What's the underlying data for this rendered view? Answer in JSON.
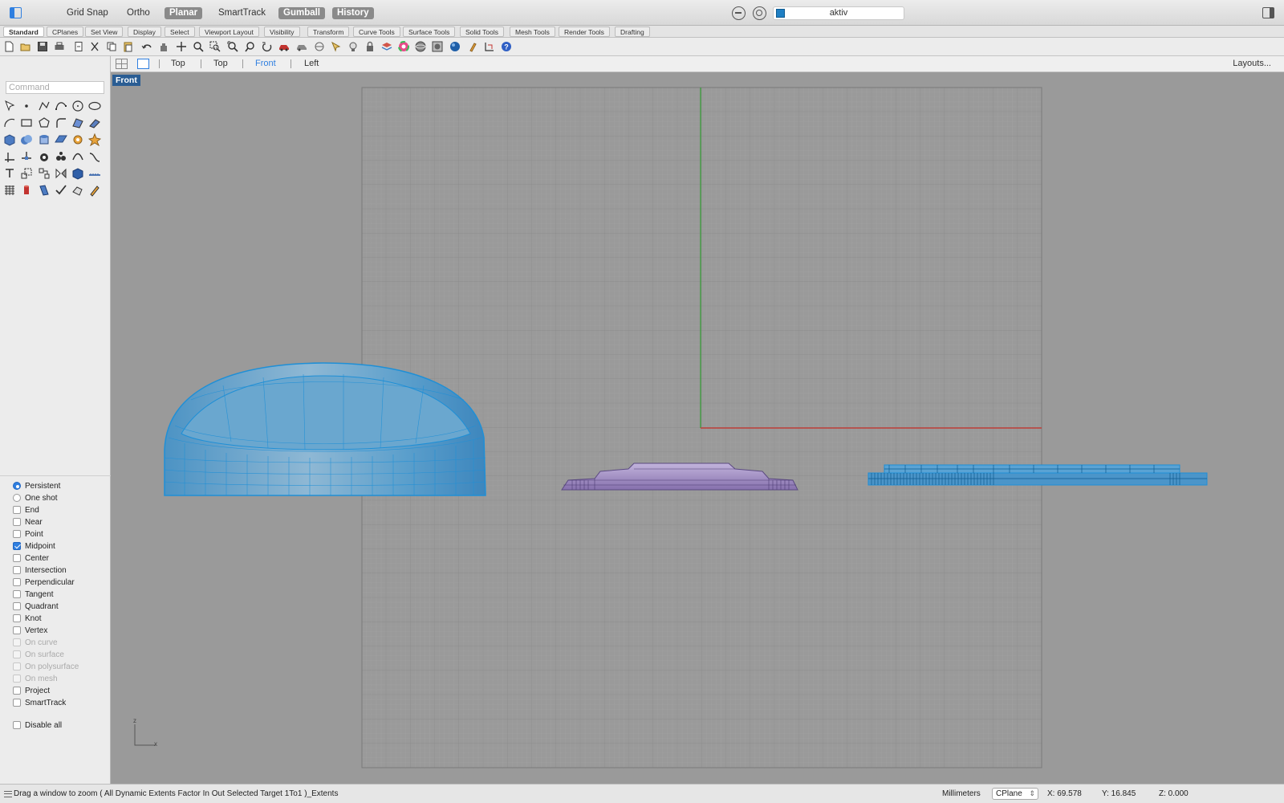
{
  "topbar": {
    "grid_snap": "Grid Snap",
    "ortho": "Ortho",
    "planar": "Planar",
    "smarttrack": "SmartTrack",
    "gumball": "Gumball",
    "history": "History",
    "layer_name": "aktiv",
    "layer_color": "#1f7fc4"
  },
  "tabs": [
    "Standard",
    "CPlanes",
    "Set View",
    "Display",
    "Select",
    "Viewport Layout",
    "Visibility",
    "Transform",
    "Curve Tools",
    "Surface Tools",
    "Solid Tools",
    "Mesh Tools",
    "Render Tools",
    "Drafting"
  ],
  "command": {
    "placeholder": "Command"
  },
  "viewport_tabs": {
    "tabs": [
      "Top",
      "Top",
      "Front",
      "Left"
    ],
    "layouts": "Layouts...",
    "active_label": "Front"
  },
  "osnap": {
    "persistent": "Persistent",
    "one_shot": "One shot",
    "items": [
      {
        "label": "End",
        "checked": false,
        "enabled": true
      },
      {
        "label": "Near",
        "checked": false,
        "enabled": true
      },
      {
        "label": "Point",
        "checked": false,
        "enabled": true
      },
      {
        "label": "Midpoint",
        "checked": true,
        "enabled": true
      },
      {
        "label": "Center",
        "checked": false,
        "enabled": true
      },
      {
        "label": "Intersection",
        "checked": false,
        "enabled": true
      },
      {
        "label": "Perpendicular",
        "checked": false,
        "enabled": true
      },
      {
        "label": "Tangent",
        "checked": false,
        "enabled": true
      },
      {
        "label": "Quadrant",
        "checked": false,
        "enabled": true
      },
      {
        "label": "Knot",
        "checked": false,
        "enabled": true
      },
      {
        "label": "Vertex",
        "checked": false,
        "enabled": true
      },
      {
        "label": "On curve",
        "checked": false,
        "enabled": false
      },
      {
        "label": "On surface",
        "checked": false,
        "enabled": false
      },
      {
        "label": "On polysurface",
        "checked": false,
        "enabled": false
      },
      {
        "label": "On mesh",
        "checked": false,
        "enabled": false
      },
      {
        "label": "Project",
        "checked": false,
        "enabled": true
      },
      {
        "label": "SmartTrack",
        "checked": false,
        "enabled": true
      }
    ],
    "disable_all": "Disable all"
  },
  "axes": {
    "z": "z",
    "x": "x"
  },
  "status": {
    "prompt": "Drag a window to zoom ( All Dynamic Extents Factor In Out Selected Target 1To1 )_Extents",
    "units": "Millimeters",
    "cplane": "CPlane",
    "x": "X: 69.578",
    "y": "Y: 16.845",
    "z": "Z: 0.000"
  },
  "colors": {
    "selection_blue": "#1f8fd6",
    "accent": "#2f7fe0",
    "object_purple": "#a290c2",
    "x_axis": "#c0403a",
    "y_axis": "#3f9a3f"
  }
}
